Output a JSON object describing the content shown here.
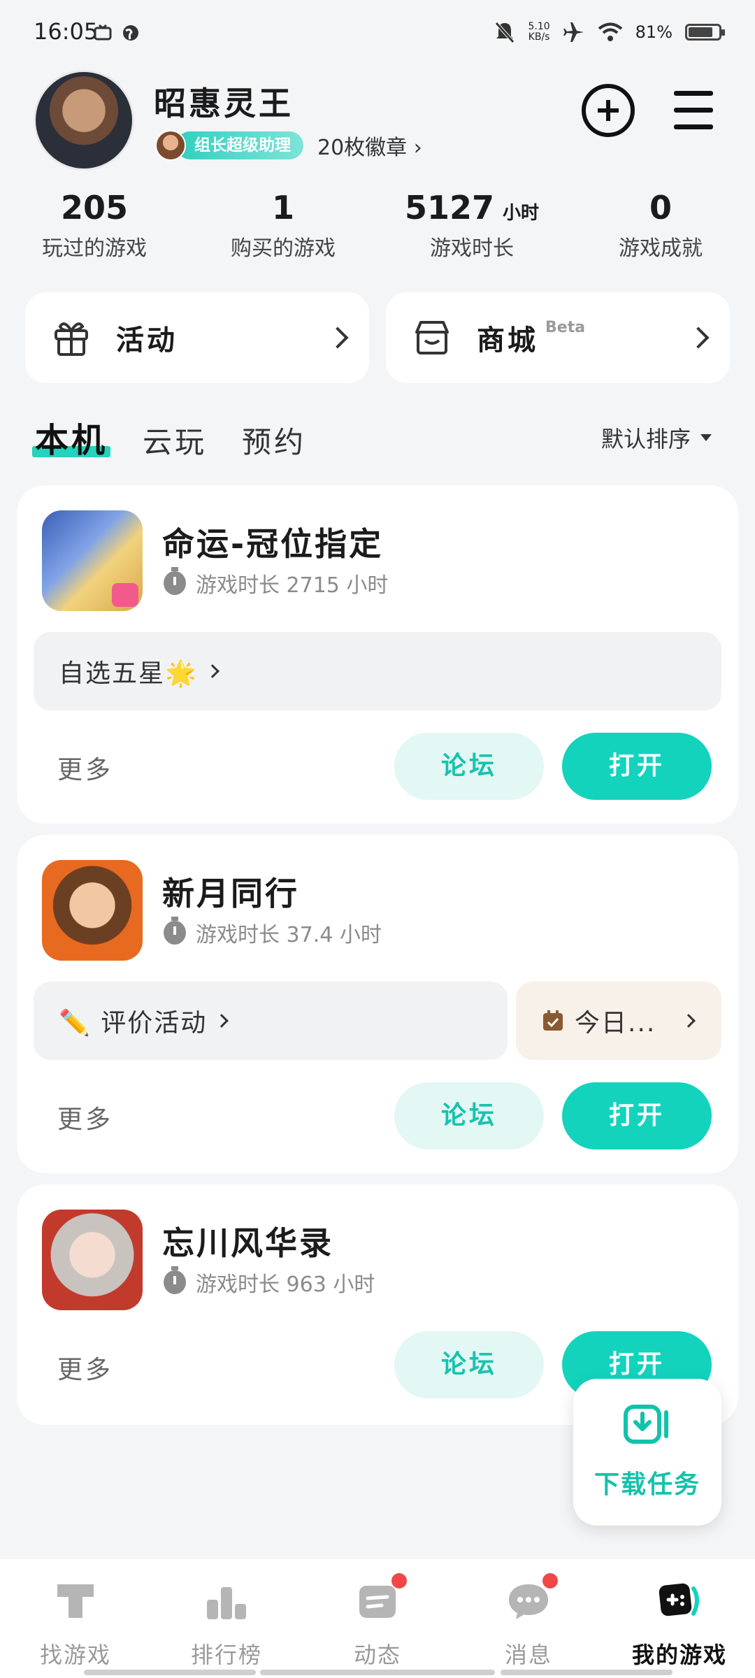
{
  "status_bar": {
    "time": "16:05",
    "net_speed_value": "5.10",
    "net_speed_unit": "KB/s",
    "battery": "81%",
    "battery_level": 0.81
  },
  "profile": {
    "username": "昭惠灵王",
    "badge_label": "组长超级助理",
    "medals": "20枚徽章"
  },
  "stats": [
    {
      "value": "205",
      "unit": "",
      "label": "玩过的游戏"
    },
    {
      "value": "1",
      "unit": "",
      "label": "购买的游戏"
    },
    {
      "value": "5127",
      "unit": "小时",
      "label": "游戏时长"
    },
    {
      "value": "0",
      "unit": "",
      "label": "游戏成就"
    }
  ],
  "quick_cards": {
    "activity": "活动",
    "mall": "商城",
    "mall_tag": "Beta"
  },
  "tabs": [
    "本机",
    "云玩",
    "预约"
  ],
  "sort_label": "默认排序",
  "games": [
    {
      "name": "命运-冠位指定",
      "playtime": "游戏时长 2715 小时",
      "promo": "自选五星🌟",
      "more": "更多",
      "forum": "论坛",
      "open": "打开"
    },
    {
      "name": "新月同行",
      "playtime": "游戏时长 37.4 小时",
      "promo": "✏️ 评价活动",
      "promo2": "今日...",
      "more": "更多",
      "forum": "论坛",
      "open": "打开"
    },
    {
      "name": "忘川风华录",
      "playtime": "游戏时长 963 小时",
      "more": "更多",
      "forum": "论坛",
      "open": "打开"
    }
  ],
  "download_task": "下载任务",
  "bottom_nav": [
    {
      "label": "找游戏",
      "icon": "find-game-icon"
    },
    {
      "label": "排行榜",
      "icon": "ranking-icon"
    },
    {
      "label": "动态",
      "icon": "feed-icon"
    },
    {
      "label": "消息",
      "icon": "message-icon"
    },
    {
      "label": "我的游戏",
      "icon": "my-games-icon"
    }
  ],
  "colors": {
    "accent": "#13d3bd",
    "badge_dot": "#f04848"
  }
}
